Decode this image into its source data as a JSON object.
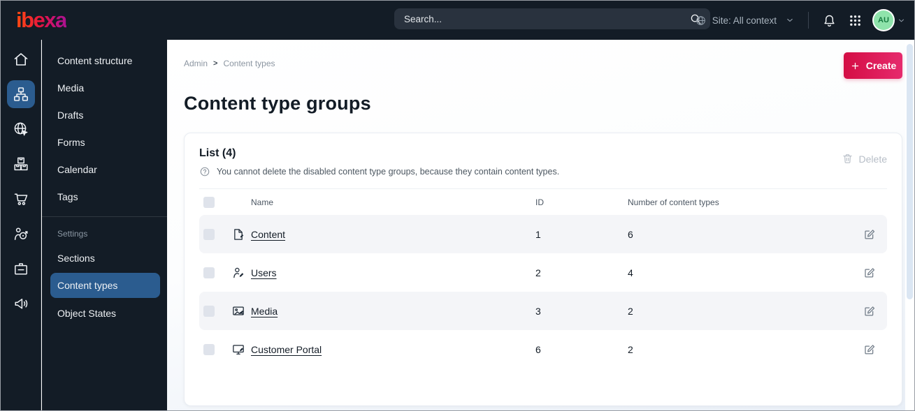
{
  "topbar": {
    "logo_text": "ibexa",
    "search_placeholder": "Search...",
    "site_context_label": "Site: All context",
    "avatar_initials": "AU"
  },
  "icon_rail": {
    "active_item": "content-structure",
    "items": [
      "home",
      "content-structure",
      "site",
      "product-catalog",
      "cart",
      "customer",
      "personalization",
      "promotions"
    ]
  },
  "sidebar": {
    "items": [
      {
        "label": "Content structure"
      },
      {
        "label": "Media"
      },
      {
        "label": "Drafts"
      },
      {
        "label": "Forms"
      },
      {
        "label": "Calendar"
      },
      {
        "label": "Tags"
      }
    ],
    "settings_header": "Settings",
    "settings_items": [
      {
        "label": "Sections"
      },
      {
        "label": "Content types",
        "selected": true
      },
      {
        "label": "Object States"
      }
    ]
  },
  "main": {
    "breadcrumb": {
      "items": [
        "Admin",
        "Content types"
      ],
      "separator": ">"
    },
    "create_button_label": "Create",
    "page_title": "Content type groups",
    "panel": {
      "list_title": "List (4)",
      "help_text": "You cannot delete the disabled content type groups, because they contain content types.",
      "delete_button_label": "Delete",
      "table": {
        "columns": [
          "Name",
          "ID",
          "Number of content types"
        ],
        "rows": [
          {
            "icon": "file-icon",
            "name": "Content",
            "id": "1",
            "count": "6"
          },
          {
            "icon": "user-icon",
            "name": "Users",
            "id": "2",
            "count": "4"
          },
          {
            "icon": "image-icon",
            "name": "Media",
            "id": "3",
            "count": "2"
          },
          {
            "icon": "monitor-icon",
            "name": "Customer Portal",
            "id": "6",
            "count": "2"
          }
        ]
      }
    }
  },
  "colors": {
    "topbar_bg": "#131c26",
    "selected_blue": "#2b5c8f",
    "brand_gradient_start": "#ff4713",
    "brand_gradient_end": "#a8128f",
    "button_gradient_start": "#d40d44",
    "button_gradient_end": "#e62a6d",
    "avatar_bg": "#8fe3ab",
    "avatar_text": "#157a40",
    "row_alt_bg": "#f4f5f8"
  }
}
